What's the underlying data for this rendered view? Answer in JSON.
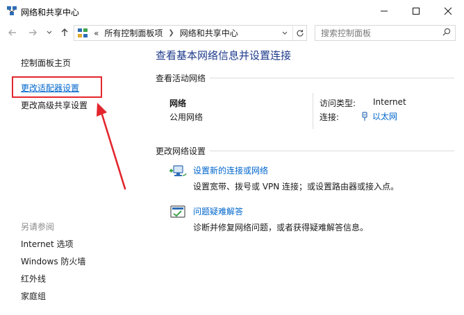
{
  "window": {
    "title": "网络和共享中心",
    "controls": {
      "minimize": "minimize",
      "maximize": "maximize",
      "close": "close"
    }
  },
  "nav": {
    "overflow": "«",
    "breadcrumbs": [
      "所有控制面板项",
      "网络和共享中心"
    ],
    "search_placeholder": "搜索控制面板"
  },
  "left_pane": {
    "links": [
      "控制面板主页",
      "更改适配器设置",
      "更改高级共享设置"
    ],
    "see_also_heading": "另请参阅",
    "see_also": [
      "Internet 选项",
      "Windows 防火墙",
      "红外线",
      "家庭组"
    ]
  },
  "main": {
    "title": "查看基本网络信息并设置连接",
    "active_section": "查看活动网络",
    "network": {
      "name": "网络",
      "type": "公用网络",
      "access_label": "访问类型:",
      "access_value": "Internet",
      "conn_label": "连接:",
      "conn_value": "以太网"
    },
    "change_section": "更改网络设置",
    "tasks": [
      {
        "link": "设置新的连接或网络",
        "desc": "设置宽带、拨号或 VPN 连接；或设置路由器或接入点。",
        "icon": "new-connection-icon"
      },
      {
        "link": "问题疑难解答",
        "desc": "诊断并修复网络问题，或者获得疑难解答信息。",
        "icon": "troubleshoot-icon"
      }
    ]
  },
  "colors": {
    "link": "#0066cc",
    "title": "#1e3b8c",
    "annotation": "#e3262d"
  }
}
